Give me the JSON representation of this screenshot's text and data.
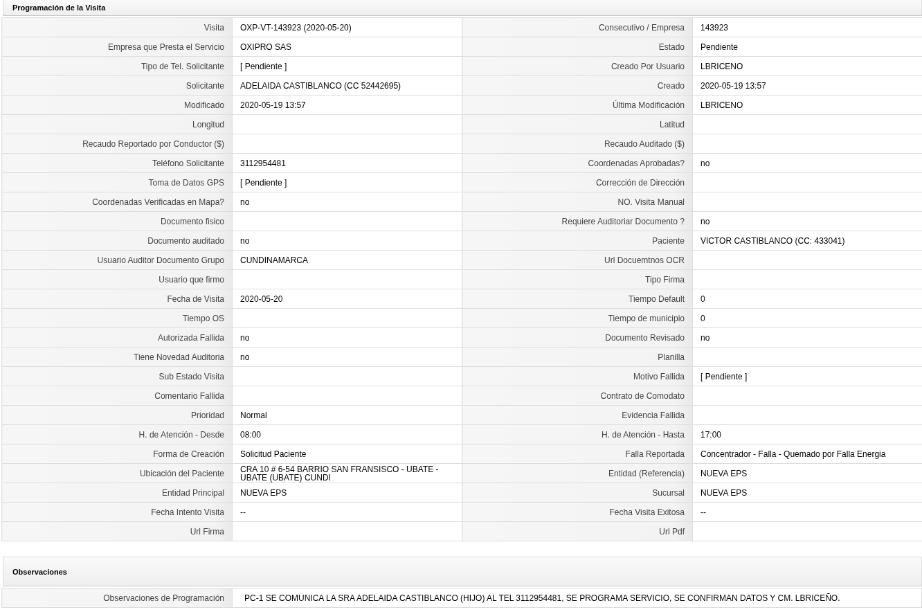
{
  "visit_section": {
    "title": "Programación de la Visita",
    "rows": [
      {
        "left": {
          "label": "Visita",
          "value": "OXP-VT-143923 (2020-05-20)"
        },
        "right": {
          "label": "Consecutivo / Empresa",
          "value": "143923"
        }
      },
      {
        "left": {
          "label": "Empresa que Presta el Servicio",
          "value": "OXIPRO SAS"
        },
        "right": {
          "label": "Estado",
          "value": "Pendiente"
        }
      },
      {
        "left": {
          "label": "Tipo de Tel. Solicitante",
          "value": "[ Pendiente ]"
        },
        "right": {
          "label": "Creado Por Usuario",
          "value": "LBRICENO"
        }
      },
      {
        "left": {
          "label": "Solicitante",
          "value": "ADELAIDA CASTIBLANCO (CC 52442695)"
        },
        "right": {
          "label": "Creado",
          "value": "2020-05-19 13:57"
        }
      },
      {
        "left": {
          "label": "Modificado",
          "value": "2020-05-19 13:57"
        },
        "right": {
          "label": "Última Modificación",
          "value": "LBRICENO"
        }
      },
      {
        "left": {
          "label": "Longitud"
        },
        "right": {
          "label": "Latitud"
        }
      },
      {
        "left": {
          "label": "Recaudo Reportado por Conductor ($)"
        },
        "right": {
          "label": "Recaudo Auditado ($)"
        }
      },
      {
        "left": {
          "label": "Teléfono Solicitante",
          "value": "3112954481"
        },
        "right": {
          "label": "Coordenadas Aprobadas?",
          "value": "no"
        }
      },
      {
        "left": {
          "label": "Toma de Datos GPS",
          "value": "[ Pendiente ]"
        },
        "right": {
          "label": "Corrección de Dirección"
        }
      },
      {
        "left": {
          "label": "Coordenadas Verificadas en Mapa?",
          "value": "no"
        },
        "right": {
          "label": "NO. Visita Manual"
        }
      },
      {
        "left": {
          "label": "Documento fisico"
        },
        "right": {
          "label": "Requiere Auditoriar Documento ?",
          "value": "no"
        }
      },
      {
        "left": {
          "label": "Documento auditado",
          "value": "no"
        },
        "right": {
          "label": "Paciente",
          "value": "VICTOR CASTIBLANCO (CC: 433041)"
        }
      },
      {
        "left": {
          "label": "Usuario Auditor Documento Grupo",
          "value": "CUNDINAMARCA"
        },
        "right": {
          "label": "Url Docuemtnos OCR"
        }
      },
      {
        "left": {
          "label": "Usuario que firmo"
        },
        "right": {
          "label": "Tipo Firma"
        }
      },
      {
        "left": {
          "label": "Fecha de Visita",
          "value": "2020-05-20"
        },
        "right": {
          "label": "Tiempo Default",
          "value": "0"
        }
      },
      {
        "left": {
          "label": "Tiempo OS"
        },
        "right": {
          "label": "Tiempo de municipio",
          "value": "0"
        }
      },
      {
        "left": {
          "label": "Autorizada Fallida",
          "value": "no"
        },
        "right": {
          "label": "Documento Revisado",
          "value": "no"
        }
      },
      {
        "left": {
          "label": "Tiene Novedad Auditoria",
          "value": "no"
        },
        "right": {
          "label": "Planilla"
        }
      },
      {
        "left": {
          "label": "Sub Estado Visita"
        },
        "right": {
          "label": "Motivo Fallida",
          "value": "[ Pendiente ]"
        }
      },
      {
        "left": {
          "label": "Comentario Fallida"
        },
        "right": {
          "label": "Contrato de Comodato"
        }
      },
      {
        "left": {
          "label": "Prioridad",
          "value": "Normal"
        },
        "right": {
          "label": "Evidencia Fallida"
        }
      },
      {
        "left": {
          "label": "H. de Atención - Desde",
          "value": "08:00"
        },
        "right": {
          "label": "H. de Atención - Hasta",
          "value": "17:00"
        }
      },
      {
        "left": {
          "label": "Forma de Creación",
          "value": "Solicitud Paciente"
        },
        "right": {
          "label": "Falla Reportada",
          "value": "Concentrador - Falla - Quemado por Falla Energia"
        }
      },
      {
        "left": {
          "label": "Ubicación del Paciente",
          "value": "CRA 10 # 6-54 BARRIO SAN FRANSISCO - UBATE - UBATE (UBATE) CUNDI"
        },
        "right": {
          "label": "Entidad (Referencia)",
          "value": "NUEVA EPS"
        }
      },
      {
        "left": {
          "label": "Entidad Principal",
          "value": "NUEVA EPS"
        },
        "right": {
          "label": "Sucursal",
          "value": "NUEVA EPS"
        }
      },
      {
        "left": {
          "label": "Fecha Intento Visita",
          "value": "--"
        },
        "right": {
          "label": "Fecha Visita Exitosa",
          "value": "--"
        }
      },
      {
        "left": {
          "label": "Url Firma"
        },
        "right": {
          "label": "Url Pdf"
        }
      }
    ]
  },
  "observations_section": {
    "title": "Observaciones",
    "rows": [
      {
        "label": "Observaciones de Programación",
        "value": "PC-1 SE COMUNICA LA SRA ADELAIDA CASTIBLANCO (HIJO) AL TEL 3112954481, SE PROGRAMA SERVICIO, SE CONFIRMAN DATOS Y CM. LBRICEÑO."
      }
    ]
  }
}
